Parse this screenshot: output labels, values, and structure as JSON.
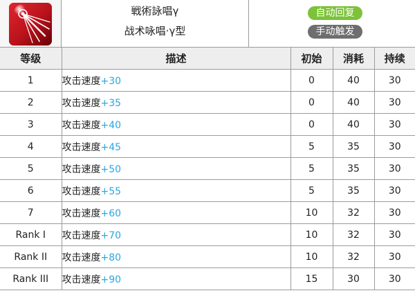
{
  "skill": {
    "name_jp": "戦術詠唱γ",
    "name_cn": "战术咏唱·γ型",
    "icon": "rifle-burst-icon",
    "badges": {
      "recovery": "自动回复",
      "trigger": "手动触发"
    }
  },
  "colors": {
    "icon_bg": "#b8121b",
    "badge_auto": "#7cc23a",
    "badge_manual": "#6e6e6e",
    "bonus_text": "#2aa6df",
    "header_bg": "#eeeeee",
    "border": "#9a9a9a"
  },
  "table": {
    "headers": {
      "level": "等级",
      "description": "描述",
      "initial": "初始",
      "cost": "消耗",
      "duration": "持续"
    },
    "rows": [
      {
        "level": "1",
        "desc_prefix": "攻击速度",
        "desc_bonus": "+30",
        "initial": "0",
        "cost": "40",
        "duration": "30"
      },
      {
        "level": "2",
        "desc_prefix": "攻击速度",
        "desc_bonus": "+35",
        "initial": "0",
        "cost": "40",
        "duration": "30"
      },
      {
        "level": "3",
        "desc_prefix": "攻击速度",
        "desc_bonus": "+40",
        "initial": "0",
        "cost": "40",
        "duration": "30"
      },
      {
        "level": "4",
        "desc_prefix": "攻击速度",
        "desc_bonus": "+45",
        "initial": "5",
        "cost": "35",
        "duration": "30"
      },
      {
        "level": "5",
        "desc_prefix": "攻击速度",
        "desc_bonus": "+50",
        "initial": "5",
        "cost": "35",
        "duration": "30"
      },
      {
        "level": "6",
        "desc_prefix": "攻击速度",
        "desc_bonus": "+55",
        "initial": "5",
        "cost": "35",
        "duration": "30"
      },
      {
        "level": "7",
        "desc_prefix": "攻击速度",
        "desc_bonus": "+60",
        "initial": "10",
        "cost": "32",
        "duration": "30"
      },
      {
        "level": "Rank I",
        "desc_prefix": "攻击速度",
        "desc_bonus": "+70",
        "initial": "10",
        "cost": "32",
        "duration": "30"
      },
      {
        "level": "Rank II",
        "desc_prefix": "攻击速度",
        "desc_bonus": "+80",
        "initial": "10",
        "cost": "32",
        "duration": "30"
      },
      {
        "level": "Rank III",
        "desc_prefix": "攻击速度",
        "desc_bonus": "+90",
        "initial": "15",
        "cost": "30",
        "duration": "30"
      }
    ]
  }
}
